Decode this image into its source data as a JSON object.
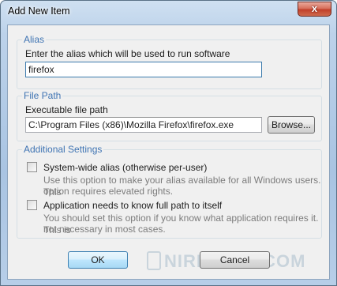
{
  "window": {
    "title": "Add New Item",
    "close_glyph": "x"
  },
  "alias": {
    "group_title": "Alias",
    "prompt": "Enter the alias which will be used to run software",
    "value": "firefox"
  },
  "file_path": {
    "group_title": "File Path",
    "label": "Executable file path",
    "value": "C:\\Program Files (x86)\\Mozilla Firefox\\firefox.exe",
    "browse_label": "Browse..."
  },
  "additional": {
    "group_title": "Additional Settings",
    "system_wide": {
      "label": "System-wide alias (otherwise per-user)",
      "description_line1": "Use this option to make your alias available for all Windows users. This",
      "description_line2": "option requires elevated rights.",
      "checked": false
    },
    "full_path": {
      "label": "Application needs to know full path to itself",
      "description_line1": "You should set this option if you know what application requires it. This is",
      "description_line2": "not necessary in most cases.",
      "checked": false
    }
  },
  "buttons": {
    "ok": "OK",
    "cancel": "Cancel"
  },
  "watermark": "NIRMALTV.COM"
}
